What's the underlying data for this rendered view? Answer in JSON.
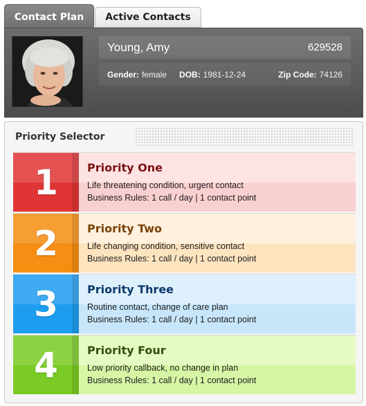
{
  "tabs": [
    {
      "label": "Contact Plan",
      "active": true
    },
    {
      "label": "Active Contacts",
      "active": false
    }
  ],
  "patient": {
    "name": "Young, Amy",
    "id": "629528",
    "gender_label": "Gender:",
    "gender": "female",
    "dob_label": "DOB:",
    "dob": "1981-12-24",
    "zip_label": "Zip Code:",
    "zip": "74126"
  },
  "selector": {
    "title": "Priority Selector",
    "priorities": [
      {
        "number": "1",
        "title": "Priority One",
        "description": "Life threatening condition, urgent contact",
        "rules": "Business Rules: 1 call / day | 1 contact point",
        "color": "#e03535"
      },
      {
        "number": "2",
        "title": "Priority Two",
        "description": "Life changing condition, sensitive contact",
        "rules": "Business Rules: 1 call / day | 1 contact point",
        "color": "#f58e12"
      },
      {
        "number": "3",
        "title": "Priority Three",
        "description": "Routine contact, change of care plan",
        "rules": "Business Rules: 1 call / day | 1 contact point",
        "color": "#1e9df0"
      },
      {
        "number": "4",
        "title": "Priority Four",
        "description": "Low priority callback, no change in plan",
        "rules": "Business Rules: 1 call / day | 1 contact point",
        "color": "#7acb25"
      }
    ]
  }
}
